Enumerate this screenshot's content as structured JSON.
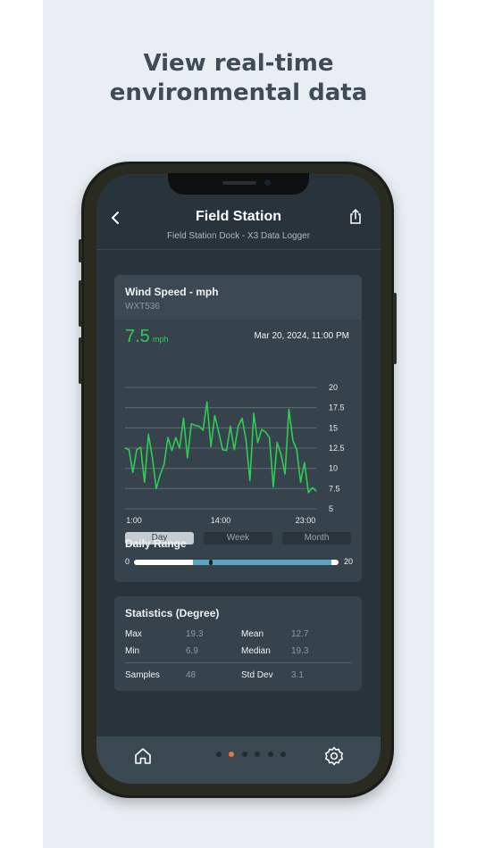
{
  "headline": {
    "line1": "View real-time",
    "line2": "environmental data"
  },
  "nav": {
    "title": "Field Station",
    "subtitle": "Field Station Dock - X3 Data Logger"
  },
  "sensor": {
    "title": "Wind Speed - mph",
    "model": "WXT536",
    "current_value": "7.5",
    "unit": "mph",
    "timestamp": "Mar 20, 2024, 11:00 PM"
  },
  "range_tabs": [
    {
      "label": "Day",
      "selected": true
    },
    {
      "label": "Week",
      "selected": false
    },
    {
      "label": "Month",
      "selected": false
    }
  ],
  "chart_data": {
    "type": "line",
    "y_ticks": [
      "20",
      "17.5",
      "15",
      "12.5",
      "10",
      "7.5",
      "5"
    ],
    "x_ticks": [
      "1:00",
      "14:00",
      "23:00"
    ],
    "ylim": [
      5,
      20
    ],
    "grid": true,
    "series": [
      {
        "color": "#2ecc55",
        "values": [
          12.5,
          12.3,
          9.5,
          12.3,
          12.6,
          8.3,
          14.2,
          11.3,
          7.5,
          9.2,
          10.5,
          13.8,
          12.2,
          13.8,
          12.5,
          16.2,
          11.3,
          15.5,
          15.3,
          15.2,
          14.7,
          18.2,
          12.7,
          16.5,
          14.5,
          12.3,
          12.2,
          15.2,
          12.3,
          15.2,
          16.2,
          13.5,
          8.5,
          16.8,
          13.2,
          14.8,
          14.5,
          13.8,
          7.7,
          13.2,
          11.7,
          9.3,
          17.3,
          13.5,
          12.3,
          8.3,
          10.7,
          7.0,
          7.6,
          7.2
        ]
      }
    ]
  },
  "daily_range": {
    "label": "Daily Range",
    "min_label": "0",
    "max_label": "20",
    "low": 0,
    "high": 20,
    "current": 7.5,
    "range_start": 5.8,
    "range_end": 19.3
  },
  "statistics": {
    "title": "Statistics (Degree)",
    "max_label": "Max",
    "max": "19.3",
    "mean_label": "Mean",
    "mean": "12.7",
    "min_label": "Min",
    "min": "6.9",
    "median_label": "Median",
    "median": "19.3",
    "samples_label": "Samples",
    "samples": "48",
    "std_label": "Std Dev",
    "std": "3.1"
  },
  "page_dots": {
    "count": 6,
    "active": 1,
    "active_color": "#e8773a"
  },
  "icons": {
    "back": "back-arrow-icon",
    "share": "share-icon",
    "home": "home-icon",
    "settings": "gear-icon"
  }
}
